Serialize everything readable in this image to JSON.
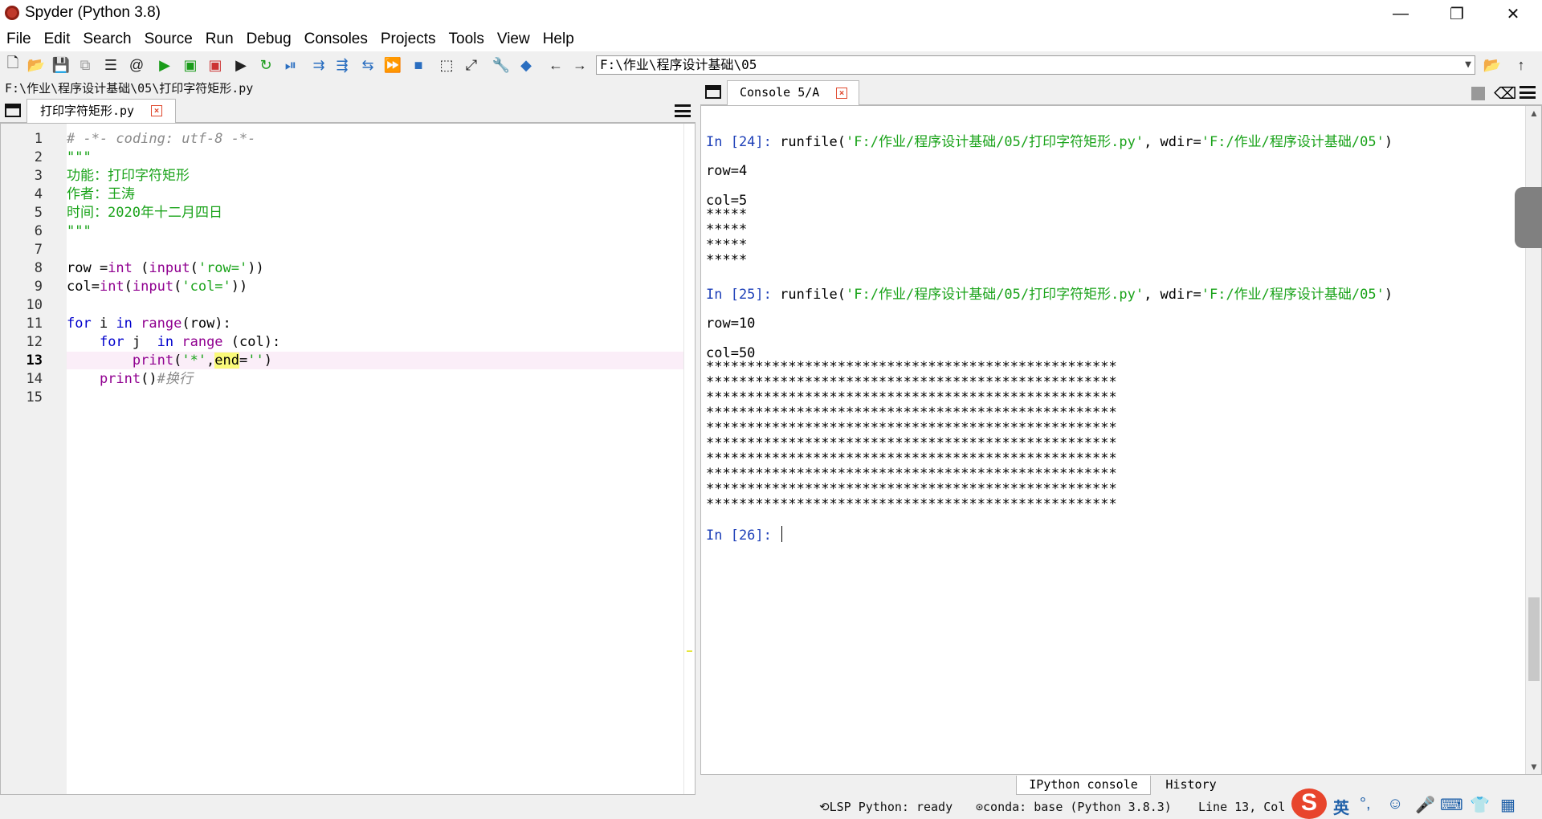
{
  "window": {
    "title": "Spyder (Python 3.8)"
  },
  "menu": [
    "File",
    "Edit",
    "Search",
    "Source",
    "Run",
    "Debug",
    "Consoles",
    "Projects",
    "Tools",
    "View",
    "Help"
  ],
  "toolbar": {
    "working_dir": "F:\\作业\\程序设计基础\\05"
  },
  "editor": {
    "file_path": "F:\\作业\\程序设计基础\\05\\打印字符矩形.py",
    "tab_label": "打印字符矩形.py",
    "current_line": 13,
    "lines": [
      "# -*- coding: utf-8 -*-",
      "\"\"\"",
      "功能：打印字符矩形",
      "作者：王涛",
      "时间：2020年十二月四日",
      "\"\"\"",
      "",
      "row =int (input('row='))",
      "col=int(input('col='))",
      "",
      "for i in range(row):",
      "    for j  in range (col):",
      "        print('*',end='')",
      "    print()#换行",
      ""
    ]
  },
  "console": {
    "tab_label": "Console 5/A",
    "run1": {
      "prompt": "In [24]: ",
      "cmd": "runfile(",
      "file": "'F:/作业/程序设计基础/05/打印字符矩形.py'",
      "wdir_label": ", wdir=",
      "wdir": "'F:/作业/程序设计基础/05'",
      "end": ")"
    },
    "run1_input_row": "row=4",
    "run1_input_col": "col=5",
    "run1_output": [
      "*****",
      "*****",
      "*****",
      "*****"
    ],
    "run2": {
      "prompt": "In [25]: ",
      "cmd": "runfile(",
      "file": "'F:/作业/程序设计基础/05/打印字符矩形.py'",
      "wdir_label": ", wdir=",
      "wdir": "'F:/作业/程序设计基础/05'",
      "end": ")"
    },
    "run2_input_row": "row=10",
    "run2_input_col": "col=50",
    "run2_output": [
      "**************************************************",
      "**************************************************",
      "**************************************************",
      "**************************************************",
      "**************************************************",
      "**************************************************",
      "**************************************************",
      "**************************************************",
      "**************************************************",
      "**************************************************"
    ],
    "current_prompt": "In [26]: "
  },
  "bottom_tabs": {
    "ipython": "IPython console",
    "history": "History"
  },
  "status": {
    "lsp": "LSP Python: ready",
    "conda": "conda: base (Python 3.8.3)",
    "position": "Line 13, Col 1"
  },
  "ime": {
    "logo": "S",
    "lang": "英"
  }
}
